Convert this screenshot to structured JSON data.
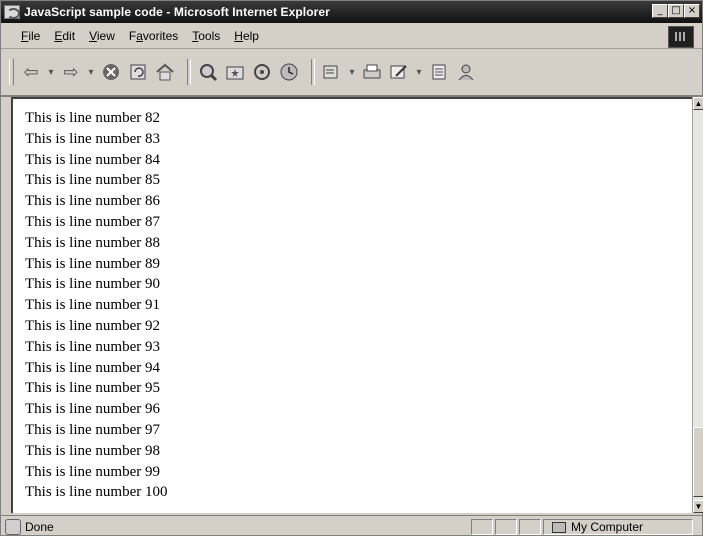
{
  "window": {
    "title": "JavaScript sample code - Microsoft Internet Explorer"
  },
  "controls": {
    "minimize": "_",
    "maximize": "□",
    "close": "×"
  },
  "menu": [
    {
      "accel": "F",
      "rest": "ile"
    },
    {
      "accel": "E",
      "rest": "dit"
    },
    {
      "accel": "V",
      "rest": "iew"
    },
    {
      "pre": "F",
      "accel": "a",
      "rest": "vorites"
    },
    {
      "accel": "T",
      "rest": "ools"
    },
    {
      "accel": "H",
      "rest": "elp"
    }
  ],
  "toolbar_icons": [
    "back-icon",
    "dropdown-arrow-icon",
    "forward-icon",
    "dropdown-arrow-icon",
    "stop-icon",
    "refresh-icon",
    "home-icon",
    "search-icon",
    "favorites-icon",
    "media-icon",
    "history-icon",
    "mail-icon",
    "print-icon",
    "edit-icon",
    "discuss-icon",
    "messenger-icon"
  ],
  "content": {
    "lines": [
      "This is line number 82",
      "This is line number 83",
      "This is line number 84",
      "This is line number 85",
      "This is line number 86",
      "This is line number 87",
      "This is line number 88",
      "This is line number 89",
      "This is line number 90",
      "This is line number 91",
      "This is line number 92",
      "This is line number 93",
      "This is line number 94",
      "This is line number 95",
      "This is line number 96",
      "This is line number 97",
      "This is line number 98",
      "This is line number 99",
      "This is line number 100"
    ]
  },
  "status": {
    "text": "Done",
    "zone": "My Computer"
  }
}
